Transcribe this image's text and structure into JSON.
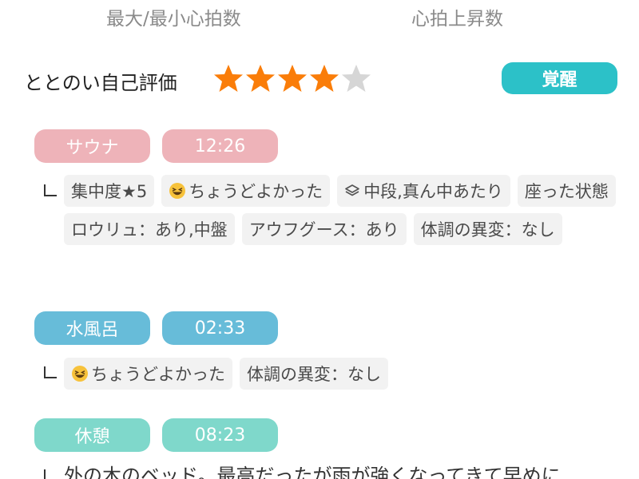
{
  "header": {
    "left_label": "最大/最小心拍数",
    "right_label": "心拍上昇数"
  },
  "rating": {
    "label": "ととのい自己評価",
    "stars_filled": 4,
    "stars_total": 5,
    "status": "覚醒",
    "colors": {
      "star_on": "#fa7d09",
      "star_off": "#d6d6d6",
      "status_bg": "#2cc1c8"
    }
  },
  "sessions": [
    {
      "type": "サウナ",
      "time": "12:26",
      "color_type": "#eeb3b9",
      "color_time": "#eeb3b9",
      "chips": [
        {
          "text": "集中度★5"
        },
        {
          "text": "ちょうどよかった",
          "icon": "grinning-face-icon"
        },
        {
          "text": "中段,真ん中あたり",
          "icon": "layers-icon"
        },
        {
          "text": "座った状態"
        },
        {
          "text": "ロウリュ：あり,中盤"
        },
        {
          "text": "アウフグース：あり"
        },
        {
          "text": "体調の異変：なし"
        }
      ]
    },
    {
      "type": "水風呂",
      "time": "02:33",
      "color_type": "#67bcd9",
      "color_time": "#67bcd9",
      "chips": [
        {
          "text": "ちょうどよかった",
          "icon": "grinning-face-icon"
        },
        {
          "text": "体調の異変：なし"
        }
      ]
    },
    {
      "type": "休憩",
      "time": "08:23",
      "color_type": "#7fd8cb",
      "color_time": "#7fd8cb",
      "note": "外の木のベッド。最高だったが雨が強くなってきて早めに"
    }
  ]
}
